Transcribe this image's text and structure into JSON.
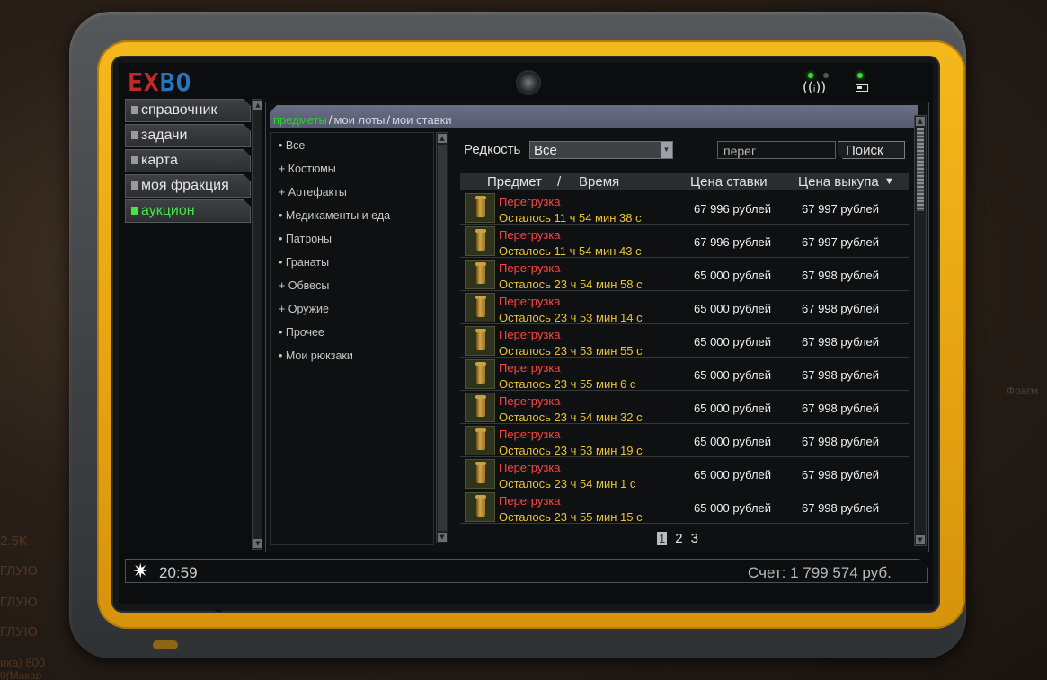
{
  "logo": {
    "left": "EX",
    "right": "BO"
  },
  "background_text": {
    "right_fragment": "Фрагм",
    "left_lines": [
      "2.5K",
      "ГЛУЮ",
      "ГЛУЮ",
      "ГЛУЮ",
      "ика) 800",
      "0(Макар"
    ]
  },
  "nav": {
    "items": [
      {
        "label": "справочник",
        "active": false
      },
      {
        "label": "задачи",
        "active": false
      },
      {
        "label": "карта",
        "active": false
      },
      {
        "label": "моя фракция",
        "active": false
      },
      {
        "label": "аукцион",
        "active": true
      }
    ]
  },
  "tabs": [
    {
      "label": "предметы",
      "active": true
    },
    {
      "label": "мои лоты",
      "active": false
    },
    {
      "label": "мои ставки",
      "active": false
    }
  ],
  "tab_separator": "/",
  "categories": [
    "• Все",
    "+ Костюмы",
    "+ Артефакты",
    "• Медикаменты и еда",
    "• Патроны",
    "• Гранаты",
    "+ Обвесы",
    "+ Оружие",
    "• Прочее",
    "• Мои рюкзаки"
  ],
  "filter": {
    "rarity_label": "Редкость",
    "rarity_value": "Все",
    "search_value": "перег",
    "search_button": "Поиск"
  },
  "table": {
    "headers": {
      "item": "Предмет",
      "slash": "/",
      "time": "Время",
      "bid": "Цена ставки",
      "buyout": "Цена выкупа",
      "sort_indicator": "▼"
    },
    "rows": [
      {
        "name": "Перегрузка",
        "time": "Осталось 11 ч 54 мин 38 с",
        "bid": "67 996 рублей",
        "buyout": "67 997 рублей"
      },
      {
        "name": "Перегрузка",
        "time": "Осталось 11 ч 54 мин 43 с",
        "bid": "67 996 рублей",
        "buyout": "67 997 рублей"
      },
      {
        "name": "Перегрузка",
        "time": "Осталось 23 ч 54 мин 58 с",
        "bid": "65 000 рублей",
        "buyout": "67 998 рублей"
      },
      {
        "name": "Перегрузка",
        "time": "Осталось 23 ч 53 мин 14 с",
        "bid": "65 000 рублей",
        "buyout": "67 998 рублей"
      },
      {
        "name": "Перегрузка",
        "time": "Осталось 23 ч 53 мин 55 с",
        "bid": "65 000 рублей",
        "buyout": "67 998 рублей"
      },
      {
        "name": "Перегрузка",
        "time": "Осталось 23 ч 55 мин 6 с",
        "bid": "65 000 рублей",
        "buyout": "67 998 рублей"
      },
      {
        "name": "Перегрузка",
        "time": "Осталось 23 ч 54 мин 32 с",
        "bid": "65 000 рублей",
        "buyout": "67 998 рублей"
      },
      {
        "name": "Перегрузка",
        "time": "Осталось 23 ч 53 мин 19 с",
        "bid": "65 000 рублей",
        "buyout": "67 998 рублей"
      },
      {
        "name": "Перегрузка",
        "time": "Осталось 23 ч 54 мин 1 с",
        "bid": "65 000 рублей",
        "buyout": "67 998 рублей"
      },
      {
        "name": "Перегрузка",
        "time": "Осталось 23 ч 55 мин 15 с",
        "bid": "65 000 рублей",
        "buyout": "67 998 рублей"
      }
    ]
  },
  "pagination": {
    "pages": [
      "1",
      "2",
      "3"
    ],
    "current": "1"
  },
  "status": {
    "star_icon": "✷",
    "time": "20:59",
    "account": "Счет: 1 799 574 руб."
  },
  "colors": {
    "bezel": "#f4b81c",
    "active_green": "#47e347",
    "item_name_red": "#ff4444",
    "time_yellow": "#e7c43a"
  }
}
